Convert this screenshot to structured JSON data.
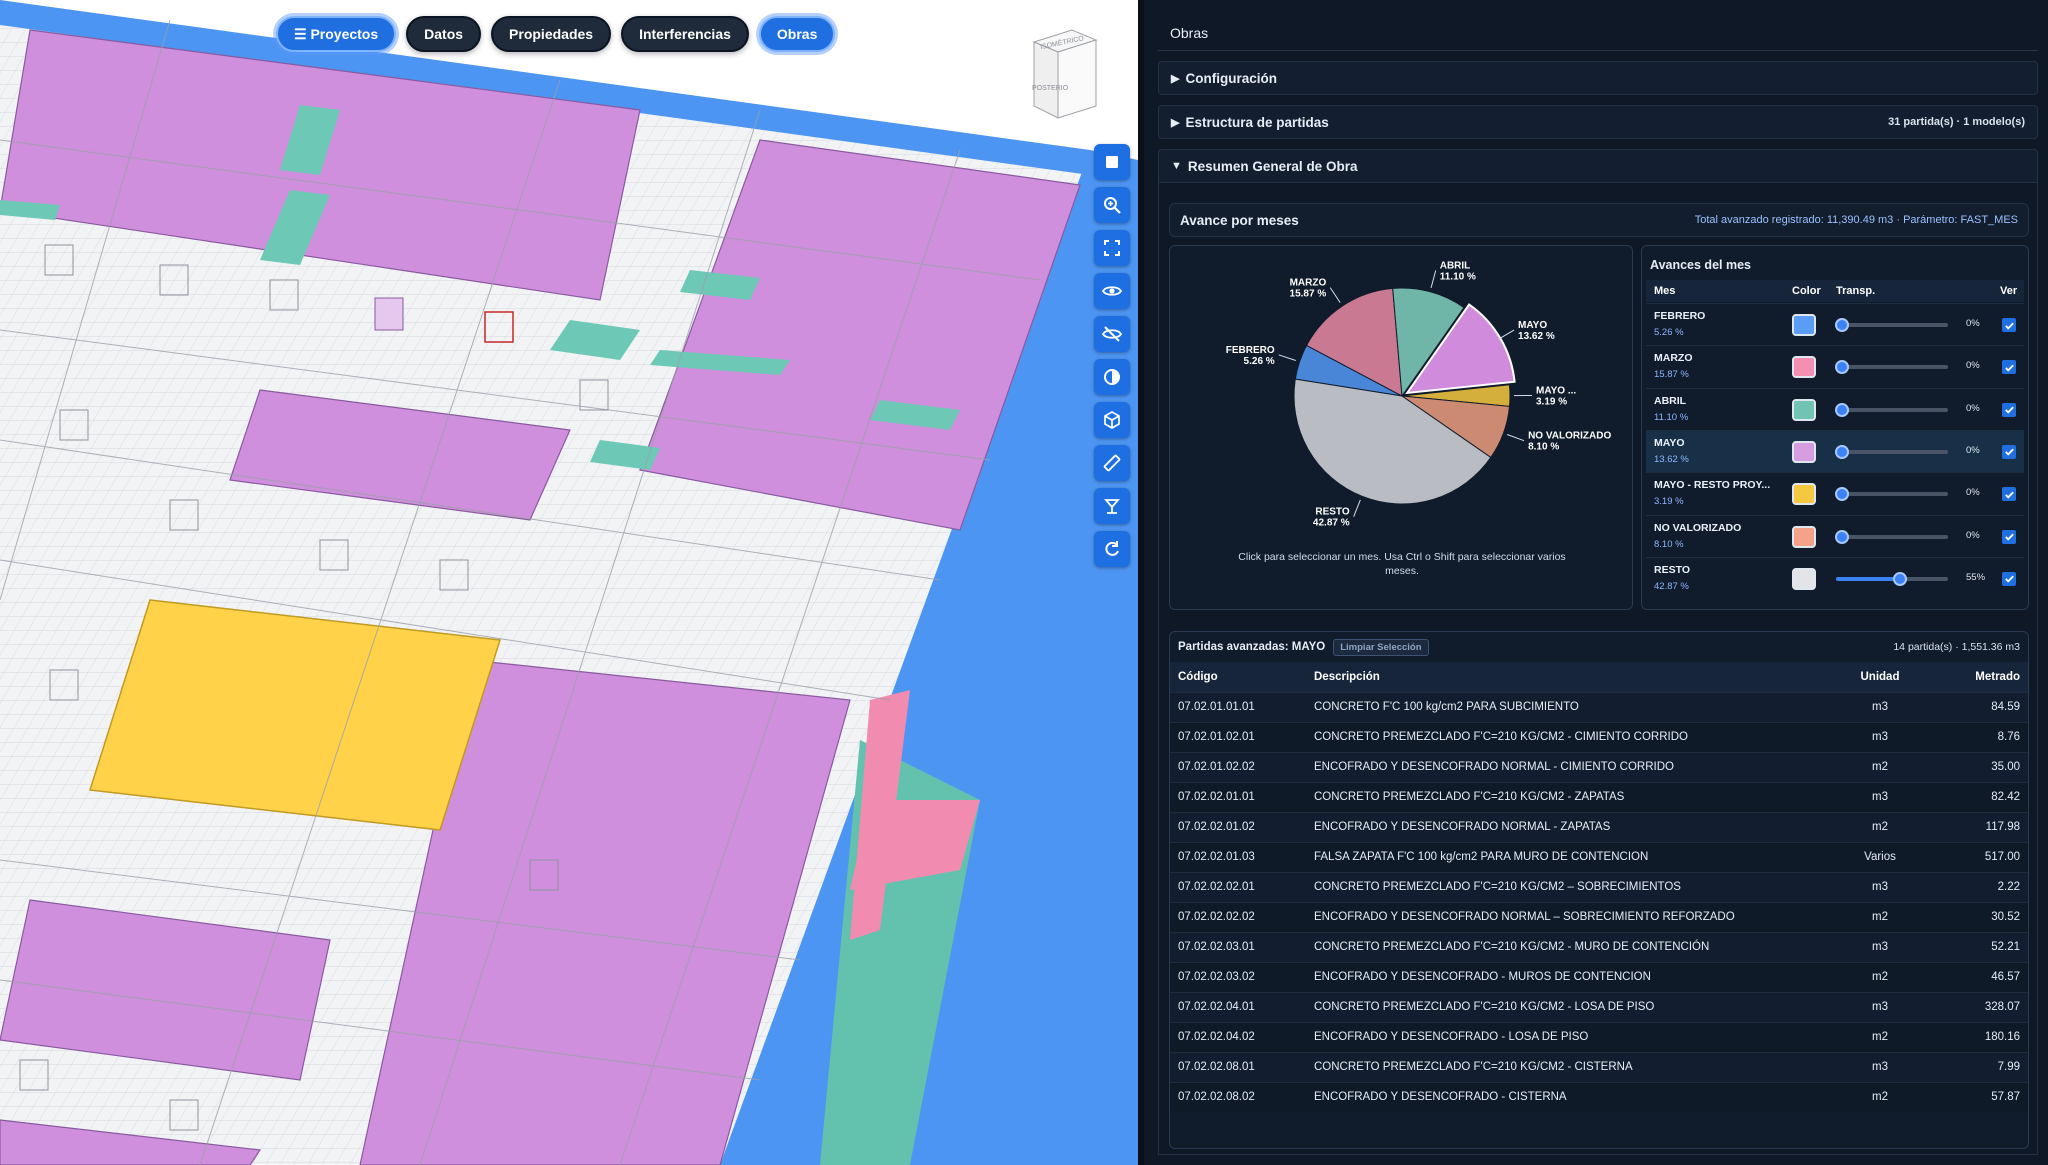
{
  "nav": {
    "items": [
      {
        "label": "☰ Proyectos",
        "active": true
      },
      {
        "label": "Datos",
        "active": false
      },
      {
        "label": "Propiedades",
        "active": false
      },
      {
        "label": "Interferencias",
        "active": false
      },
      {
        "label": "Obras",
        "active": true
      }
    ]
  },
  "viewcube": {
    "top_label": "ISOMÉTRICO",
    "face_label": "POSTERIO"
  },
  "toolbar": {
    "tools": [
      "square-icon",
      "zoom-in-icon",
      "fit-view-icon",
      "eye-icon",
      "eye-off-icon",
      "contrast-icon",
      "cube-icon",
      "ruler-icon",
      "section-plane-icon",
      "reset-icon"
    ]
  },
  "panel": {
    "title": "Obras",
    "config_label": "Configuración",
    "estructura_label": "Estructura de partidas",
    "estructura_meta": "31 partida(s) · 1 modelo(s)",
    "resumen_label": "Resumen General de Obra",
    "caret_closed": "▶",
    "caret_open": "▼"
  },
  "avance": {
    "title": "Avance por meses",
    "meta": "Total avanzado registrado: 11,390.49 m3 · Parámetro: FAST_MES",
    "hint_line1": "Click para seleccionar un mes. Usa Ctrl o Shift para seleccionar varios",
    "hint_line2": "meses."
  },
  "chart_data": {
    "type": "pie",
    "slices": [
      {
        "name": "FEBRERO",
        "value": 5.26,
        "label": "5.26 %",
        "color": "#4a86d8"
      },
      {
        "name": "MARZO",
        "value": 15.87,
        "label": "15.87 %",
        "color": "#c97a92"
      },
      {
        "name": "ABRIL",
        "value": 11.1,
        "label": "11.10 %",
        "color": "#6fb5a8"
      },
      {
        "name": "MAYO",
        "value": 13.62,
        "label": "13.62 %",
        "color": "#d18bdd"
      },
      {
        "name": "MAYO ...",
        "value": 3.19,
        "label": "3.19 %",
        "color": "#d4af3c"
      },
      {
        "name": "NO VALORIZADO",
        "value": 8.1,
        "label": "8.10 %",
        "color": "#cc8a72"
      },
      {
        "name": "RESTO",
        "value": 42.87,
        "label": "42.87 %",
        "color": "#b9bcc2"
      }
    ],
    "selected": "MAYO"
  },
  "avances_mes": {
    "title": "Avances del mes",
    "headers": {
      "mes": "Mes",
      "color": "Color",
      "transp": "Transp.",
      "ver": "Ver"
    },
    "rows": [
      {
        "name": "FEBRERO",
        "pct": "5.26 %",
        "color": "#5b9cf5",
        "transp": 0,
        "transp_label": "0%",
        "checked": true,
        "selected": false
      },
      {
        "name": "MARZO",
        "pct": "15.87 %",
        "color": "#f48fb1",
        "transp": 0,
        "transp_label": "0%",
        "checked": true,
        "selected": false
      },
      {
        "name": "ABRIL",
        "pct": "11.10 %",
        "color": "#6fc4b4",
        "transp": 0,
        "transp_label": "0%",
        "checked": true,
        "selected": false
      },
      {
        "name": "MAYO",
        "pct": "13.62 %",
        "color": "#d69ee0",
        "transp": 0,
        "transp_label": "0%",
        "checked": true,
        "selected": true
      },
      {
        "name": "MAYO - RESTO PROY...",
        "pct": "3.19 %",
        "color": "#f5c842",
        "transp": 0,
        "transp_label": "0%",
        "checked": true,
        "selected": false
      },
      {
        "name": "NO VALORIZADO",
        "pct": "8.10 %",
        "color": "#f4a38a",
        "transp": 0,
        "transp_label": "0%",
        "checked": true,
        "selected": false
      },
      {
        "name": "RESTO",
        "pct": "42.87 %",
        "color": "#e2e4e8",
        "transp": 55,
        "transp_label": "55%",
        "checked": true,
        "selected": false
      }
    ]
  },
  "partidas": {
    "title": "Partidas avanzadas: MAYO",
    "clear_label": "Limpiar Selección",
    "meta": "14 partida(s) · 1,551.36 m3",
    "headers": {
      "codigo": "Código",
      "descripcion": "Descripción",
      "unidad": "Unidad",
      "metrado": "Metrado"
    },
    "rows": [
      {
        "codigo": "07.02.01.01.01",
        "descripcion": "CONCRETO F'C 100 kg/cm2 PARA SUBCIMIENTO",
        "unidad": "m3",
        "metrado": "84.59"
      },
      {
        "codigo": "07.02.01.02.01",
        "descripcion": "CONCRETO PREMEZCLADO F'C=210 KG/CM2 - CIMIENTO CORRIDO",
        "unidad": "m3",
        "metrado": "8.76"
      },
      {
        "codigo": "07.02.01.02.02",
        "descripcion": "ENCOFRADO Y DESENCOFRADO NORMAL - CIMIENTO CORRIDO",
        "unidad": "m2",
        "metrado": "35.00"
      },
      {
        "codigo": "07.02.02.01.01",
        "descripcion": "CONCRETO PREMEZCLADO F'C=210 KG/CM2 - ZAPATAS",
        "unidad": "m3",
        "metrado": "82.42"
      },
      {
        "codigo": "07.02.02.01.02",
        "descripcion": "ENCOFRADO Y DESENCOFRADO NORMAL - ZAPATAS",
        "unidad": "m2",
        "metrado": "117.98"
      },
      {
        "codigo": "07.02.02.01.03",
        "descripcion": "FALSA ZAPATA F'C 100 kg/cm2 PARA MURO DE CONTENCION",
        "unidad": "Varios",
        "metrado": "517.00"
      },
      {
        "codigo": "07.02.02.02.01",
        "descripcion": "CONCRETO PREMEZCLADO F'C=210 KG/CM2 – SOBRECIMIENTOS",
        "unidad": "m3",
        "metrado": "2.22"
      },
      {
        "codigo": "07.02.02.02.02",
        "descripcion": "ENCOFRADO Y DESENCOFRADO NORMAL – SOBRECIMIENTO REFORZADO",
        "unidad": "m2",
        "metrado": "30.52"
      },
      {
        "codigo": "07.02.02.03.01",
        "descripcion": "CONCRETO PREMEZCLADO F'C=210 KG/CM2 - MURO DE CONTENCIÓN",
        "unidad": "m3",
        "metrado": "52.21"
      },
      {
        "codigo": "07.02.02.03.02",
        "descripcion": "ENCOFRADO Y DESENCOFRADO - MUROS DE CONTENCION",
        "unidad": "m2",
        "metrado": "46.57"
      },
      {
        "codigo": "07.02.02.04.01",
        "descripcion": "CONCRETO PREMEZCLADO F'C=210 KG/CM2 - LOSA DE PISO",
        "unidad": "m3",
        "metrado": "328.07"
      },
      {
        "codigo": "07.02.02.04.02",
        "descripcion": "ENCOFRADO Y DESENCOFRADO - LOSA DE PISO",
        "unidad": "m2",
        "metrado": "180.16"
      },
      {
        "codigo": "07.02.02.08.01",
        "descripcion": "CONCRETO PREMEZCLADO F'C=210 KG/CM2 - CISTERNA",
        "unidad": "m3",
        "metrado": "7.99"
      },
      {
        "codigo": "07.02.02.08.02",
        "descripcion": "ENCOFRADO Y DESENCOFRADO - CISTERNA",
        "unidad": "m2",
        "metrado": "57.87"
      }
    ]
  },
  "model_colors": {
    "slab": "#cf8fdc",
    "slab_edge": "#8a5aa0",
    "beam": "#6dc9b5",
    "yellow": "#ffd24a",
    "blue": "#4d95f2",
    "pink": "#f28bb0",
    "teal": "#62c2ae"
  }
}
